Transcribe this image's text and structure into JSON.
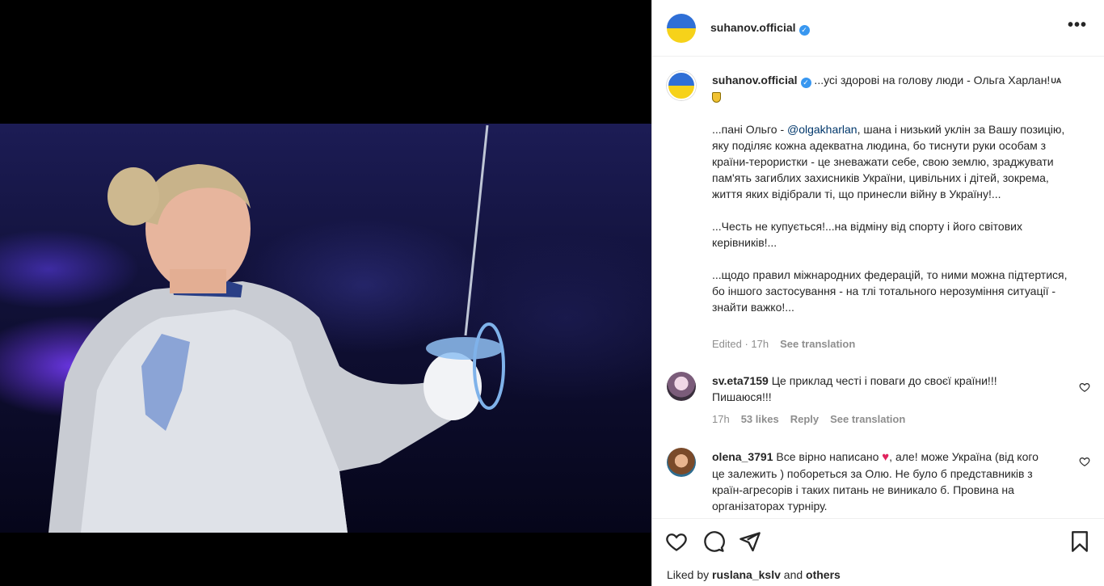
{
  "post": {
    "author": "suhanov.official",
    "more_icon": "more-horizontal-icon",
    "caption": {
      "author": "suhanov.official",
      "line1": " ...усі здорові на голову люди - Ольга Харлан!",
      "ua_badge": "UA",
      "p1_before": "...пані Ольго - ",
      "p1_mention": "@olgakharlan",
      "p1_after": ", шана і низький уклін за Вашу позицію, яку поділяє кожна адекватна людина, бо тиснути руки особам з країни-терористки - це зневажати себе, свою землю, зраджувати пам'ять загиблих захисників України, цивільних і дітей, зокрема, життя яких відібрали ті, що принесли війну в Україну!...",
      "p2": "...Честь не купується!...на відміну від спорту і його світових керівників!...",
      "p3": "...щодо правил міжнародних федерацій, то ними можна підтертися, бо іншого застосування - на тлі тотального нерозуміння ситуації - знайти важко!...",
      "edited": "Edited · 17h",
      "see_translation": "See translation"
    },
    "comments": [
      {
        "user": "sv.eta7159",
        "text": " Це приклад честі і поваги до своєї країни!!! Пишаюся!!!",
        "time": "17h",
        "likes": "53 likes",
        "reply": "Reply",
        "see_translation": "See translation"
      },
      {
        "user": "olena_3791",
        "text_before": " Все вірно написано ",
        "text_after": ", але! може Україна (від кого це залежить ) побореться за Олю. Не було б представників з країн-агресорів і таких питань не виникало б. Провина на організаторах турніру."
      }
    ],
    "actions": [
      "heart-icon",
      "comment-icon",
      "share-icon",
      "bookmark-icon"
    ],
    "liked_by": {
      "prefix": "Liked by ",
      "user": "ruslana_kslv",
      "middle": " and ",
      "others": "others"
    }
  },
  "colors": {
    "verified": "#3897f0",
    "mention": "#00376b",
    "flag_blue": "#2f6fd6",
    "flag_yellow": "#f6d21a"
  }
}
